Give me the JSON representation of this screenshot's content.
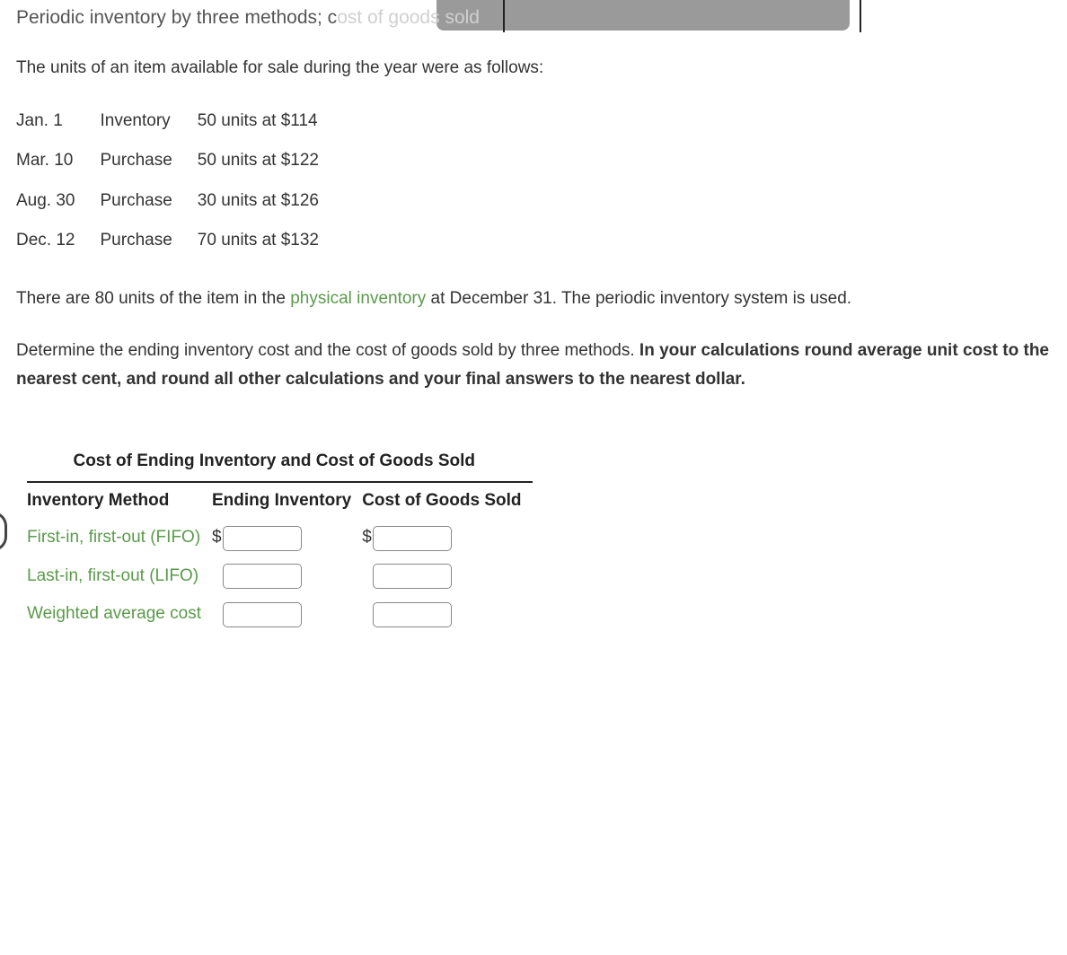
{
  "title": {
    "plain": "Periodic inventory by three methods; c",
    "overlay1": "ost of",
    "overlay2": " goods sold"
  },
  "intro": "The units of an item available for sale during the year were as follows:",
  "inventory_rows": [
    {
      "date": "Jan. 1",
      "type": "Inventory",
      "desc": "50 units at $114"
    },
    {
      "date": "Mar. 10",
      "type": "Purchase",
      "desc": "50 units at $122"
    },
    {
      "date": "Aug. 30",
      "type": "Purchase",
      "desc": "30 units at $126"
    },
    {
      "date": "Dec. 12",
      "type": "Purchase",
      "desc": "70 units at $132"
    }
  ],
  "para1_pre": "There are 80 units of the item in the ",
  "para1_link": "physical inventory",
  "para1_post": " at December 31. The periodic inventory system is used.",
  "para2_pre": "Determine the ending inventory cost and the cost of goods sold by three methods. ",
  "para2_bold": "In your calculations round average unit cost to the nearest cent, and round all other calculations and your final answers to the nearest dollar.",
  "answer": {
    "heading": "Cost of Ending Inventory and Cost of Goods Sold",
    "col_method": "Inventory Method",
    "col_ending": "Ending Inventory",
    "col_cogs": "Cost of Goods Sold",
    "rows": [
      {
        "label": "First-in, first-out (FIFO)",
        "prefix": "$"
      },
      {
        "label": "Last-in, first-out (LIFO)",
        "prefix": ""
      },
      {
        "label": "Weighted average cost",
        "prefix": ""
      }
    ]
  }
}
